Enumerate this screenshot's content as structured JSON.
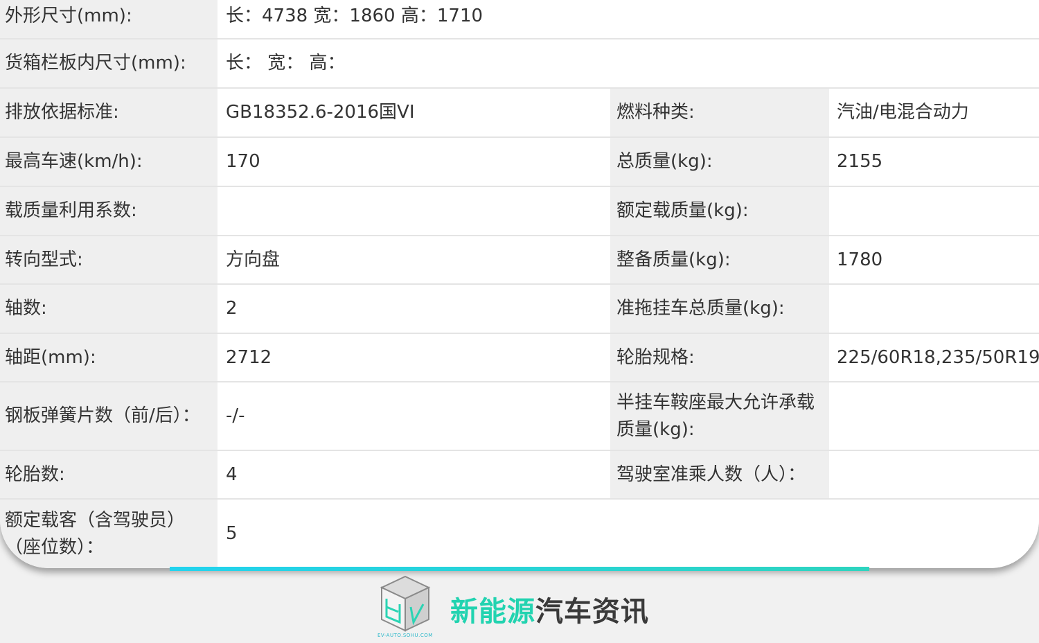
{
  "rows": [
    {
      "label": "外形尺寸(mm):",
      "value": "长：4738 宽：1860 高：1710"
    },
    {
      "label": "货箱栏板内尺寸(mm):",
      "value": "长：  宽：  高："
    },
    {
      "label": "排放依据标准:",
      "value": "GB18352.6-2016国VI",
      "label2": "燃料种类:",
      "value2": "汽油/电混合动力"
    },
    {
      "label": "最高车速(km/h):",
      "value": "170",
      "label2": "总质量(kg):",
      "value2": "2155"
    },
    {
      "label": "载质量利用系数:",
      "value": "",
      "label2": "额定载质量(kg):",
      "value2": ""
    },
    {
      "label": "转向型式:",
      "value": "方向盘",
      "label2": "整备质量(kg):",
      "value2": "1780"
    },
    {
      "label": "轴数:",
      "value": "2",
      "label2": "准拖挂车总质量(kg):",
      "value2": ""
    },
    {
      "label": "轴距(mm):",
      "value": "2712",
      "label2": "轮胎规格:",
      "value2": "225/60R18,235/50R19"
    },
    {
      "label": "钢板弹簧片数（前/后）：",
      "value": "-/-",
      "label2": "半挂车鞍座最大允许承载质量(kg):",
      "value2": ""
    },
    {
      "label": "轮胎数:",
      "value": "4",
      "label2": "驾驶室准乘人数（人）：",
      "value2": ""
    },
    {
      "label": "额定载客（含驾驶员）（座位数）：",
      "value": "5"
    }
  ],
  "footer": {
    "brand_green": "新能源",
    "brand_dark": "汽车资讯",
    "logo_caption": "EV-AUTO.SOHU.COM",
    "logo_icon": "cube-logo-icon",
    "colors": {
      "accent": "#22d3b0",
      "bar_start": "#22d3ee",
      "bar_end": "#2dd4bf"
    }
  }
}
